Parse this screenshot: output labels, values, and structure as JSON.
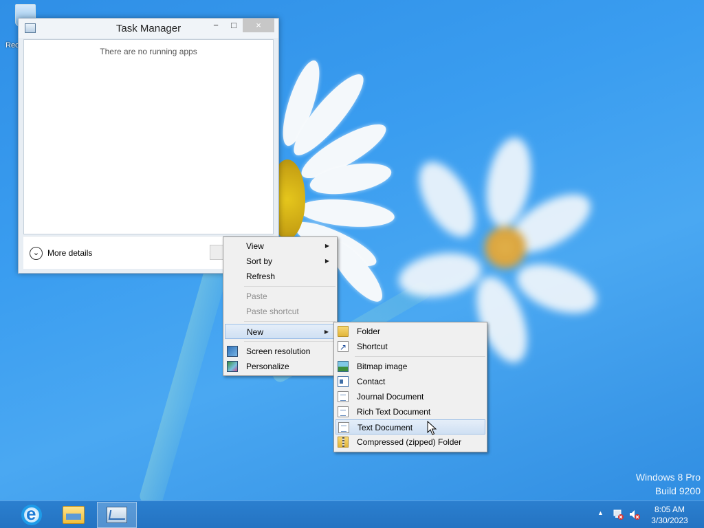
{
  "desktop": {
    "recycle_bin_label": "Rec",
    "watermark": {
      "line1": "Windows 8 Pro",
      "line2": "Build 9200"
    }
  },
  "task_manager": {
    "title": "Task Manager",
    "buttons": {
      "minimize": "−",
      "maximize": "□",
      "close": "×"
    },
    "empty_message": "There are no running apps",
    "more_details": "More details",
    "more_details_icon": "chevron-down-icon"
  },
  "context_menu": {
    "items": [
      {
        "label": "View",
        "submenu": true,
        "enabled": true
      },
      {
        "label": "Sort by",
        "submenu": true,
        "enabled": true
      },
      {
        "label": "Refresh",
        "submenu": false,
        "enabled": true
      },
      {
        "label": "Paste",
        "submenu": false,
        "enabled": false
      },
      {
        "label": "Paste shortcut",
        "submenu": false,
        "enabled": false
      },
      {
        "label": "New",
        "submenu": true,
        "enabled": true,
        "active": true
      },
      {
        "label": "Screen resolution",
        "icon": "monitor-icon",
        "enabled": true
      },
      {
        "label": "Personalize",
        "icon": "personalize-icon",
        "enabled": true
      }
    ],
    "arrow_glyph": "▶"
  },
  "new_submenu": {
    "items": [
      {
        "label": "Folder",
        "icon": "folder-icon"
      },
      {
        "label": "Shortcut",
        "icon": "shortcut-icon"
      },
      {
        "label": "Bitmap image",
        "icon": "bitmap-icon"
      },
      {
        "label": "Contact",
        "icon": "contact-icon"
      },
      {
        "label": "Journal Document",
        "icon": "journal-document-icon"
      },
      {
        "label": "Rich Text Document",
        "icon": "rich-text-document-icon"
      },
      {
        "label": "Text Document",
        "icon": "text-document-icon",
        "hovered": true
      },
      {
        "label": "Compressed (zipped) Folder",
        "icon": "zip-folder-icon"
      }
    ]
  },
  "taskbar": {
    "apps": [
      {
        "name": "Internet Explorer",
        "icon": "internet-explorer-icon"
      },
      {
        "name": "File Explorer",
        "icon": "file-explorer-icon"
      },
      {
        "name": "Task Manager",
        "icon": "task-manager-icon",
        "active": true
      }
    ],
    "tray": {
      "overflow_glyph": "▲",
      "time": "8:05 AM",
      "date": "3/30/2023"
    }
  },
  "colors": {
    "desktop_blue": "#3a9df0",
    "taskbar_blue": "#2473c2",
    "menu_bg": "#f0f0f0",
    "menu_highlight": "#cfe0f3",
    "close_button": "#c7c7c7"
  }
}
